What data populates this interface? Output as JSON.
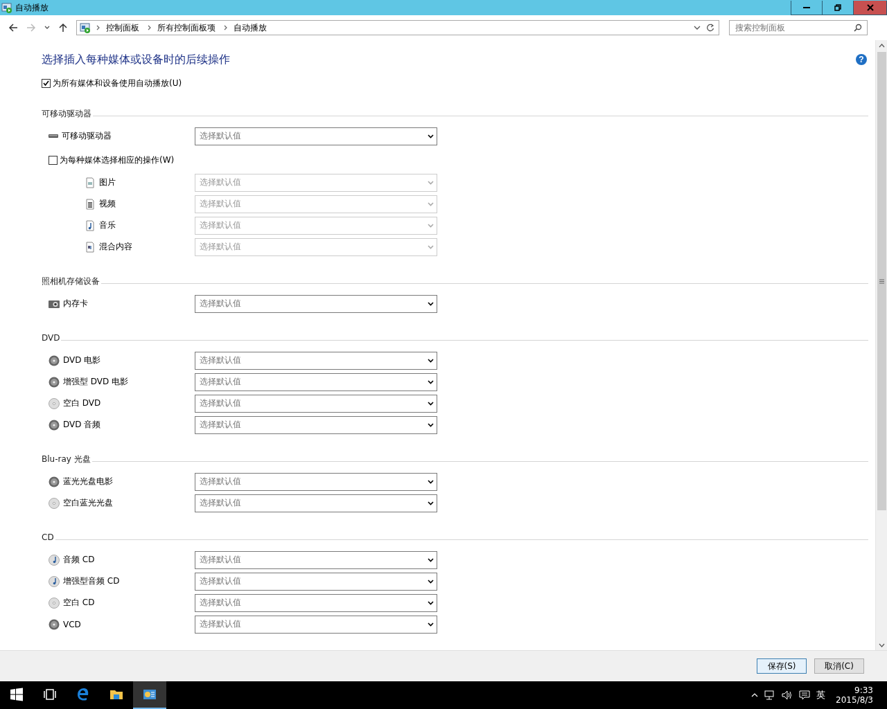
{
  "window": {
    "title": "自动播放"
  },
  "address_bar": {
    "crumbs": [
      "控制面板",
      "所有控制面板项",
      "自动播放"
    ]
  },
  "search": {
    "placeholder": "搜索控制面板"
  },
  "content": {
    "heading": "选择插入每种媒体或设备时的后续操作",
    "help": "?",
    "autoplay_all": {
      "label": "为所有媒体和设备使用自动播放(U)",
      "checked": true
    },
    "sections": [
      {
        "title": "可移动驱动器",
        "items": [
          {
            "kind": "drive",
            "label": "可移动驱动器",
            "value": "选择默认值",
            "disabled": false
          },
          {
            "kind": "checkbox",
            "label": "为每种媒体选择相应的操作(W)",
            "checked": false
          },
          {
            "kind": "picture",
            "label": "图片",
            "value": "选择默认值",
            "disabled": true
          },
          {
            "kind": "video",
            "label": "视频",
            "value": "选择默认值",
            "disabled": true
          },
          {
            "kind": "music",
            "label": "音乐",
            "value": "选择默认值",
            "disabled": true
          },
          {
            "kind": "mixed",
            "label": "混合内容",
            "value": "选择默认值",
            "disabled": true
          }
        ]
      },
      {
        "title": "照相机存储设备",
        "items": [
          {
            "kind": "card",
            "label": "内存卡",
            "value": "选择默认值",
            "disabled": false
          }
        ]
      },
      {
        "title": "DVD",
        "items": [
          {
            "kind": "disc",
            "label": "DVD 电影",
            "value": "选择默认值",
            "disabled": false
          },
          {
            "kind": "disc",
            "label": "增强型 DVD 电影",
            "value": "选择默认值",
            "disabled": false
          },
          {
            "kind": "blank",
            "label": "空白 DVD",
            "value": "选择默认值",
            "disabled": false
          },
          {
            "kind": "disc",
            "label": "DVD 音频",
            "value": "选择默认值",
            "disabled": false
          }
        ]
      },
      {
        "title": "Blu-ray 光盘",
        "items": [
          {
            "kind": "disc",
            "label": "蓝光光盘电影",
            "value": "选择默认值",
            "disabled": false
          },
          {
            "kind": "blank",
            "label": "空白蓝光光盘",
            "value": "选择默认值",
            "disabled": false
          }
        ]
      },
      {
        "title": "CD",
        "items": [
          {
            "kind": "audio",
            "label": "音频 CD",
            "value": "选择默认值",
            "disabled": false
          },
          {
            "kind": "audio",
            "label": "增强型音频 CD",
            "value": "选择默认值",
            "disabled": false
          },
          {
            "kind": "blank",
            "label": "空白 CD",
            "value": "选择默认值",
            "disabled": false
          },
          {
            "kind": "disc",
            "label": "VCD",
            "value": "选择默认值",
            "disabled": false
          }
        ]
      }
    ]
  },
  "buttons": [
    "保存(S)",
    "取消(C)"
  ],
  "taskbar": {
    "language": "英",
    "time": "9:33",
    "date": "2015/8/3"
  }
}
